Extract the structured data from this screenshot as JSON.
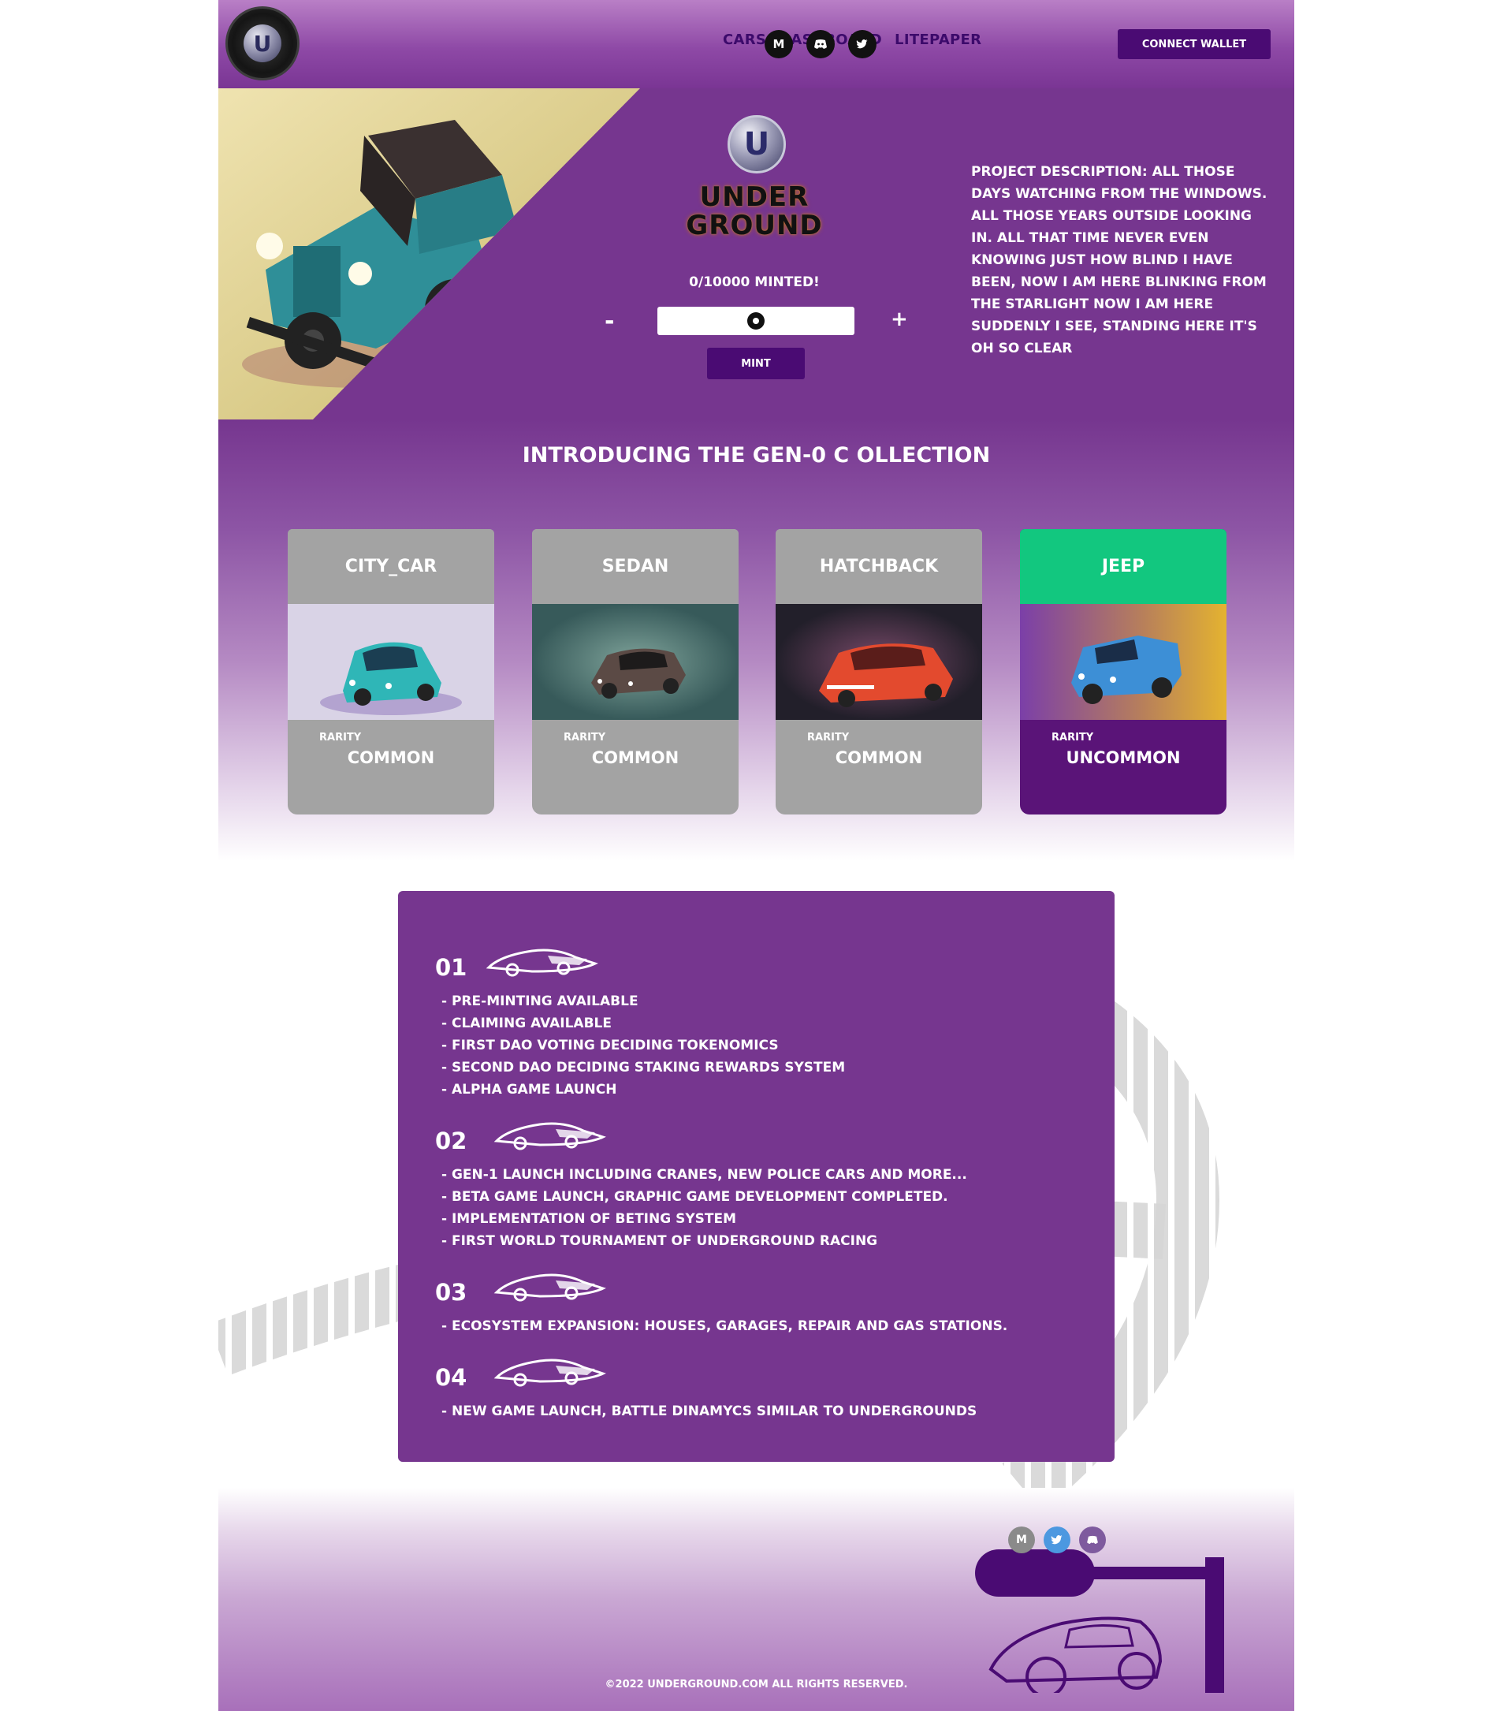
{
  "header": {
    "logo_alt": "U",
    "nav": [
      "CARS",
      "DASHBOARD",
      "LITEPAPER"
    ],
    "social": [
      {
        "icon": "medium-icon",
        "glyph": "M"
      },
      {
        "icon": "discord-icon",
        "glyph": "◉"
      },
      {
        "icon": "twitter-icon",
        "glyph": "✉"
      }
    ],
    "connect_label": "CONNECT WALLET"
  },
  "hero": {
    "emblem_letter": "U",
    "brand_line1": "UNDER",
    "brand_line2": "GROUND",
    "minted": "0/10000 MINTED!",
    "minus": "-",
    "plus": "+",
    "mint_label": "MINT",
    "description": "PROJECT DESCRIPTION: ALL THOSE DAYS WATCHING FROM THE WINDOWS. ALL THOSE YEARS OUTSIDE LOOKING IN. ALL THAT TIME NEVER EVEN KNOWING JUST HOW BLIND I HAVE BEEN, NOW I AM HERE BLINKING FROM THE STARLIGHT NOW I AM HERE SUDDENLY I SEE, STANDING HERE IT'S OH SO CLEAR"
  },
  "collection": {
    "title": "INTRODUCING THE GEN-0 C OLLECTION",
    "cards": [
      {
        "name": "CITY_CAR",
        "rarity_label": "RARITY",
        "rarity": "COMMON",
        "color": "#2fb6b7"
      },
      {
        "name": "SEDAN",
        "rarity_label": "RARITY",
        "rarity": "COMMON",
        "color": "#5b4a45"
      },
      {
        "name": "HATCHBACK",
        "rarity_label": "RARITY",
        "rarity": "COMMON",
        "color": "#e34a2e"
      },
      {
        "name": "JEEP",
        "rarity_label": "RARITY",
        "rarity": "UNCOMMON",
        "color": "#3d8fd6"
      }
    ]
  },
  "roadmap": {
    "phases": [
      {
        "num": "01",
        "items": [
          "- PRE-MINTING AVAILABLE",
          "- CLAIMING AVAILABLE",
          "- FIRST DAO VOTING DECIDING TOKENOMICS",
          "- SECOND DAO DECIDING STAKING REWARDS SYSTEM",
          "- ALPHA GAME LAUNCH"
        ]
      },
      {
        "num": "02",
        "items": [
          "- GEN-1 LAUNCH INCLUDING CRANES, NEW POLICE CARS AND MORE...",
          "- BETA GAME LAUNCH, GRAPHIC GAME DEVELOPMENT COMPLETED.",
          "- IMPLEMENTATION OF BETING SYSTEM",
          "- FIRST WORLD TOURNAMENT OF UNDERGROUND RACING"
        ]
      },
      {
        "num": "03",
        "items": [
          "- ECOSYSTEM EXPANSION: HOUSES, GARAGES, REPAIR AND GAS STATIONS."
        ]
      },
      {
        "num": "04",
        "items": [
          "- NEW GAME LAUNCH, BATTLE DINAMYCS SIMILAR TO UNDERGROUNDS"
        ]
      }
    ]
  },
  "footer": {
    "copyright": "©2022 UNDERGROUND.COM   ALL RIGHTS RESERVED."
  },
  "colors": {
    "brand_purple": "#76368f",
    "dark_purple": "#4a0b73",
    "accent_green": "#12c77f",
    "card_grey": "#a3a3a3"
  }
}
